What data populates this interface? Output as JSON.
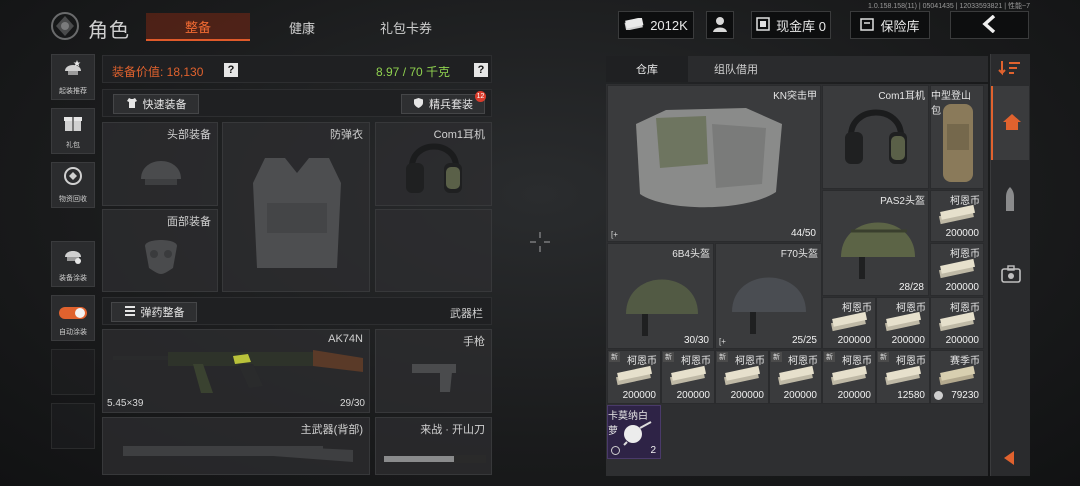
{
  "version_text": "1.0.158.158(11) | 05041435 | 12033593821 | 性能~7",
  "header": {
    "title": "角色",
    "tabs": [
      {
        "label": "整备",
        "active": true
      },
      {
        "label": "健康",
        "active": false
      },
      {
        "label": "礼包卡券",
        "active": false
      }
    ],
    "currency": "2012K",
    "cash_vault": "现金库 0",
    "safe_vault": "保险库",
    "back_icon": "chevron-left-icon"
  },
  "sidebar": {
    "items": [
      {
        "label": "起装推荐",
        "icon": "helmet-star-icon"
      },
      {
        "label": "礼包",
        "icon": "gift-icon"
      },
      {
        "label": "物资回收",
        "icon": "recycle-icon"
      },
      {
        "label": "装备涂装",
        "icon": "paint-icon"
      },
      {
        "label": "自动涂装",
        "icon": "toggle-icon"
      }
    ]
  },
  "equipment": {
    "value_label": "装备价值: 18,130",
    "weight_label": "8.97 / 70 千克",
    "quick_equip": "快速装备",
    "elite_kit": "精兵套装",
    "elite_badge": "12",
    "slots": {
      "head": "头部装备",
      "armor": "防弹衣",
      "earphone": "Com1耳机",
      "face": "面部装备"
    },
    "ammo_equip": "弹药整备",
    "weapon_bar": "武器栏",
    "primary": {
      "name": "AK74N",
      "caliber": "5.45×39",
      "ammo": "29/30"
    },
    "pistol": "手枪",
    "secondary": "主武器(背部)",
    "melee": "来战 · 开山刀"
  },
  "storage": {
    "tabs": [
      {
        "label": "仓库",
        "active": true
      },
      {
        "label": "组队借用",
        "active": false
      }
    ],
    "items": {
      "kn_armor": {
        "name": "KN突击甲",
        "qty": "44/50"
      },
      "com1": {
        "name": "Com1耳机"
      },
      "backpack": {
        "name": "中型登山包"
      },
      "pas2": {
        "name": "PAS2头盔",
        "qty": "28/28"
      },
      "coin_1": {
        "name": "柯恩币",
        "qty": "200000"
      },
      "b64": {
        "name": "6B4头盔",
        "qty": "30/30"
      },
      "f70": {
        "name": "F70头盔",
        "qty": "25/25"
      },
      "coin_2": {
        "name": "柯恩币",
        "qty": "200000"
      },
      "coin_3": {
        "name": "柯恩币",
        "qty": "200000"
      },
      "coin_4": {
        "name": "柯恩币",
        "qty": "200000"
      },
      "coin_5": {
        "name": "柯恩币",
        "qty": "200000"
      },
      "coin_6": {
        "name": "柯恩币",
        "qty": "200000"
      },
      "coin_7": {
        "name": "柯恩币",
        "qty": "200000"
      },
      "coin_8": {
        "name": "柯恩币",
        "qty": "200000"
      },
      "coin_9": {
        "name": "柯恩币",
        "qty": "200000"
      },
      "coin_10": {
        "name": "柯恩币",
        "qty": "200000"
      },
      "coin_11": {
        "name": "柯恩币",
        "qty": "12580"
      },
      "season_coin": {
        "name": "赛季币",
        "qty": "79230"
      },
      "radish": {
        "name": "卡莫纳白萝",
        "qty": "2"
      }
    },
    "new_tag": "新"
  },
  "colors": {
    "accent": "#f06a32",
    "weight_green": "#8fd14f",
    "value_orange": "#e0622e"
  }
}
